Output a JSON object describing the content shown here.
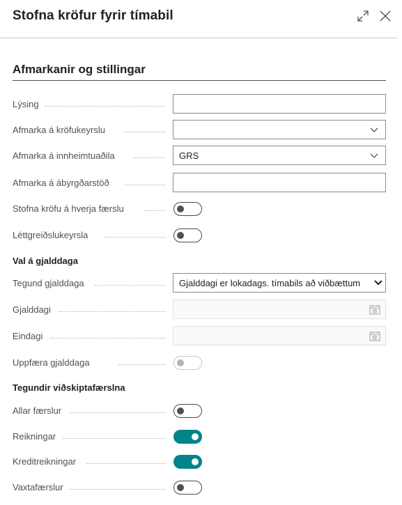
{
  "dialog": {
    "title": "Stofna kröfur fyrir tímabil"
  },
  "section": {
    "title": "Afmarkanir og stillingar"
  },
  "fields": {
    "lysing": {
      "label": "Lýsing",
      "value": ""
    },
    "krofukeyrslu": {
      "label": "Afmarka á kröfukeyrslu",
      "value": ""
    },
    "innheimtuadila": {
      "label": "Afmarka á innheimtuaðila",
      "value": "GRS"
    },
    "abyrgdarstod": {
      "label": "Afmarka á ábyrgðarstöð",
      "value": ""
    },
    "krofu_hverja": {
      "label": "Stofna kröfu á hverja færslu",
      "on": false
    },
    "lettgreidslu": {
      "label": "Léttgreiðslukeyrsla",
      "on": false
    }
  },
  "group_gjalddaga": {
    "label": "Val á gjalddaga",
    "tegund": {
      "label": "Tegund gjalddaga",
      "value": "Gjalddagi er lokadags. tímabils að viðbættum"
    },
    "gjalddagi": {
      "label": "Gjalddagi",
      "value": ""
    },
    "eindagi": {
      "label": "Eindagi",
      "value": ""
    },
    "uppfaera": {
      "label": "Uppfæra gjalddaga",
      "on": false
    }
  },
  "group_tegundir": {
    "label": "Tegundir viðskiptafærslna",
    "allar": {
      "label": "Allar færslur",
      "on": false
    },
    "reikningar": {
      "label": "Reikningar",
      "on": true
    },
    "kredit": {
      "label": "Kreditreikningar",
      "on": true
    },
    "vaxta": {
      "label": "Vaxtafærslur",
      "on": false
    }
  },
  "colors": {
    "toggle_on": "#008489",
    "accent_line": "#505050"
  }
}
